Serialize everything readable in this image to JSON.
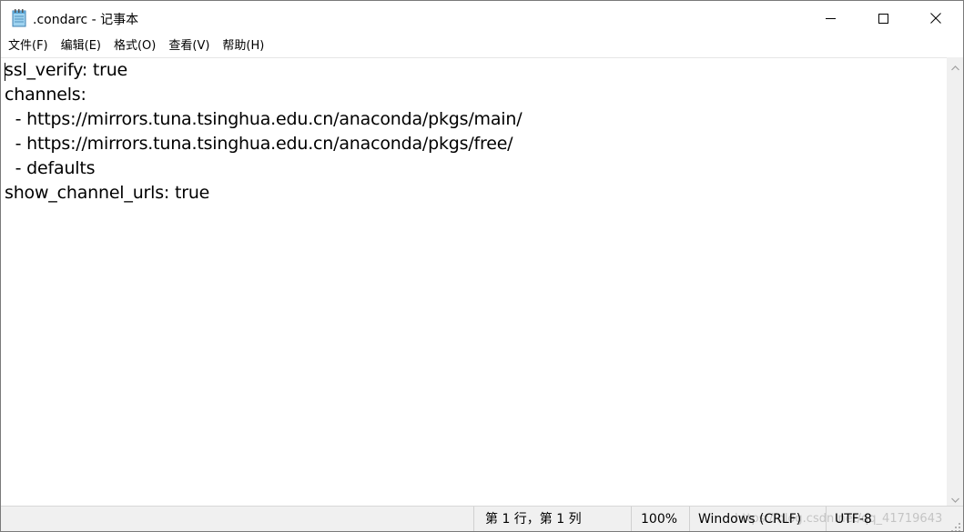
{
  "window": {
    "title": ".condarc - 记事本"
  },
  "icons": {
    "app": "notepad-icon",
    "minimize": "minimize-icon",
    "maximize": "maximize-icon",
    "close": "close-icon",
    "scroll_up": "chevron-up-icon",
    "scroll_down": "chevron-down-icon",
    "grip": "resize-grip-icon"
  },
  "menu": {
    "items": [
      "文件(F)",
      "编辑(E)",
      "格式(O)",
      "查看(V)",
      "帮助(H)"
    ]
  },
  "editor": {
    "lines": [
      "ssl_verify: true",
      "channels:",
      "  - https://mirrors.tuna.tsinghua.edu.cn/anaconda/pkgs/main/",
      "  - https://mirrors.tuna.tsinghua.edu.cn/anaconda/pkgs/free/",
      "  - defaults",
      "show_channel_urls: true"
    ]
  },
  "statusbar": {
    "position": "第 1 行，第 1 列",
    "zoom": "100%",
    "line_ending": "Windows (CRLF)",
    "encoding": "UTF-8",
    "watermark": "https://blog.csdn.net/qq_41719643"
  },
  "colors": {
    "background": "#ffffff",
    "statusbar": "#f0f0f0",
    "text": "#000000"
  }
}
